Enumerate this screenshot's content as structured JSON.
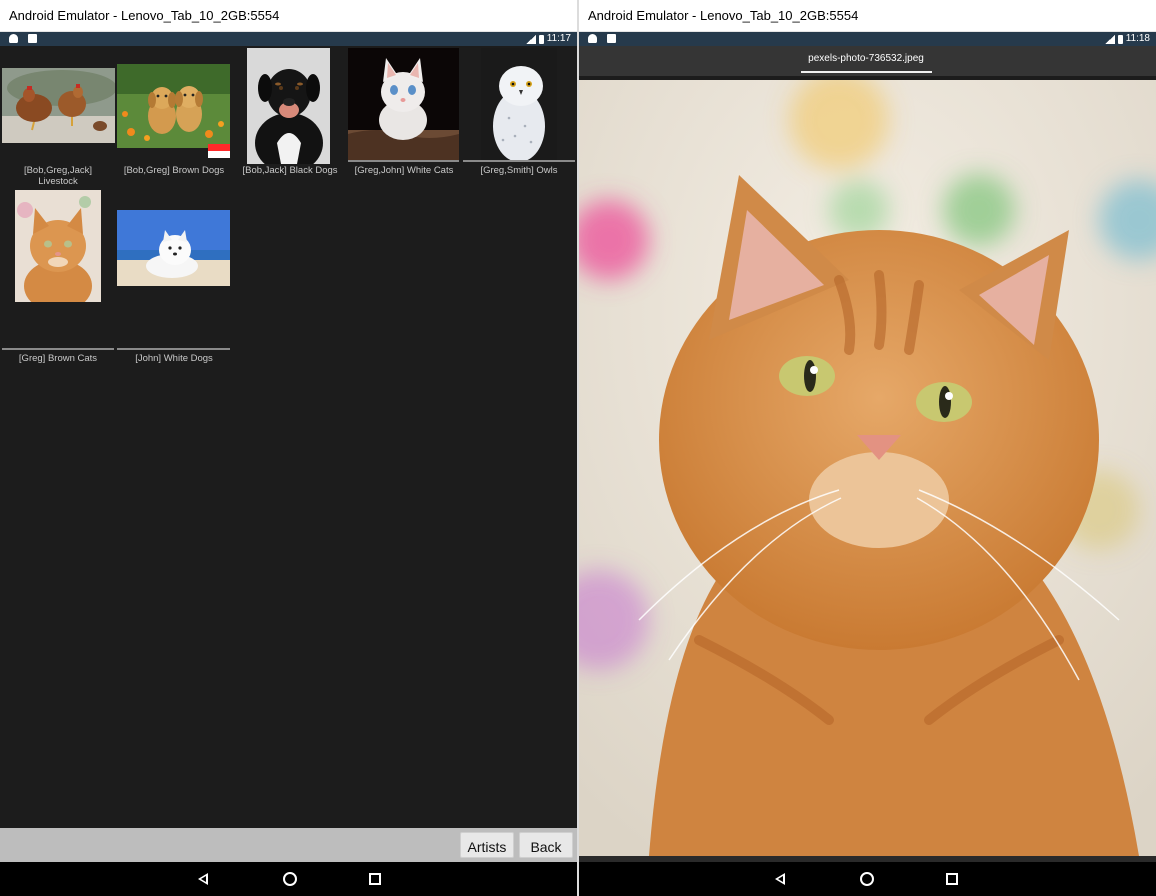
{
  "left_window": {
    "title": "Android Emulator - Lenovo_Tab_10_2GB:5554",
    "status_time": "11:17",
    "gallery": {
      "tiles": [
        {
          "caption_line1": "[Bob,Greg,Jack]",
          "caption_line2": "Livestock",
          "subject": "chickens"
        },
        {
          "caption_line1": "[Bob,Greg] Brown Dogs",
          "subject": "golden-puppies"
        },
        {
          "caption_line1": "[Bob,Jack] Black Dogs",
          "subject": "black-dog"
        },
        {
          "caption_line1": "[Greg,John] White Cats",
          "subject": "white-kitten"
        },
        {
          "caption_line1": "[Greg,Smith] Owls",
          "subject": "snowy-owl"
        },
        {
          "caption_line1": "[Greg] Brown Cats",
          "subject": "orange-cat"
        },
        {
          "caption_line1": "[John] White Dogs",
          "subject": "white-dog-beach"
        }
      ]
    },
    "buttons": {
      "artists": "Artists",
      "back": "Back"
    }
  },
  "right_window": {
    "title": "Android Emulator - Lenovo_Tab_10_2GB:5554",
    "status_time": "11:18",
    "tab_label": "pexels-photo-736532.jpeg",
    "photo_subject": "orange-tabby-cat"
  },
  "colors": {
    "app_background": "#1c1c1c",
    "status_bar": "#263a4c",
    "bottom_bar": "#bdbdbd",
    "nav_bar": "#000000"
  }
}
